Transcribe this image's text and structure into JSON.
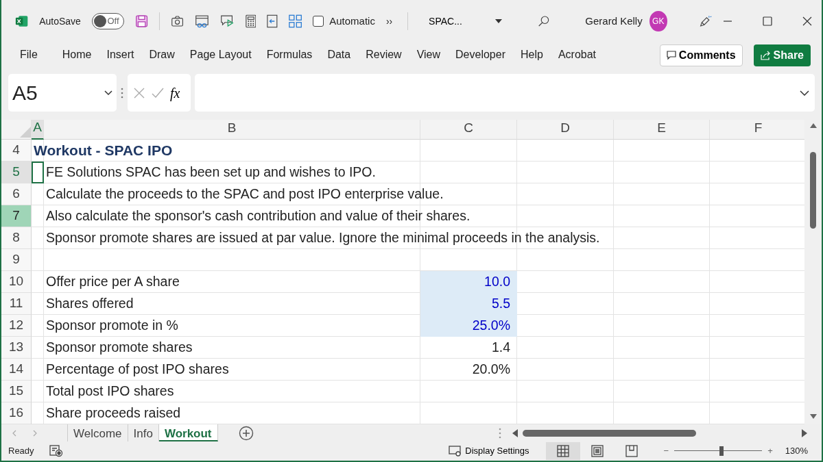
{
  "title_bar": {
    "autosave_label": "AutoSave",
    "autosave_on": false,
    "autosave_state": "Off",
    "calc_mode": {
      "label": "Automatic",
      "checked": false
    },
    "more": "››",
    "file_name": "SPAC...",
    "user_name": "Gerard Kelly",
    "user_initials": "GK"
  },
  "ribbon_tabs": [
    {
      "label": "File",
      "selected": false
    },
    {
      "label": "Home",
      "selected": false
    },
    {
      "label": "Insert",
      "selected": false
    },
    {
      "label": "Draw",
      "selected": false
    },
    {
      "label": "Page Layout",
      "selected": false
    },
    {
      "label": "Formulas",
      "selected": false
    },
    {
      "label": "Data",
      "selected": false
    },
    {
      "label": "Review",
      "selected": false
    },
    {
      "label": "View",
      "selected": false
    },
    {
      "label": "Developer",
      "selected": false
    },
    {
      "label": "Help",
      "selected": false
    },
    {
      "label": "Acrobat",
      "selected": false
    }
  ],
  "comments_button": "Comments",
  "share_button": "Share",
  "formula_bar": {
    "name_box": "A5",
    "function_label": "fx"
  },
  "sheet": {
    "columns": [
      {
        "label": "A",
        "selected": true
      },
      {
        "label": "B",
        "selected": false
      },
      {
        "label": "C",
        "selected": false
      },
      {
        "label": "D",
        "selected": false
      },
      {
        "label": "E",
        "selected": false
      },
      {
        "label": "F",
        "selected": false
      }
    ],
    "rows": [
      {
        "number": "4",
        "active": false,
        "hovered": false,
        "title": "Workout - SPAC IPO"
      },
      {
        "number": "5",
        "active": true,
        "hovered": false,
        "text": "FE Solutions SPAC has been set up and wishes to IPO."
      },
      {
        "number": "6",
        "active": false,
        "hovered": false,
        "text": "Calculate the proceeds to the SPAC and post IPO enterprise value."
      },
      {
        "number": "7",
        "active": false,
        "hovered": true,
        "text": "Also calculate the sponsor's cash contribution and value of their shares."
      },
      {
        "number": "8",
        "active": false,
        "hovered": false,
        "text": "Sponsor promote shares are issued at par value. Ignore the minimal proceeds in the analysis."
      },
      {
        "number": "9",
        "active": false,
        "hovered": false
      },
      {
        "number": "10",
        "active": false,
        "hovered": false,
        "text": "Offer price per A share",
        "value": "10.0",
        "input": true
      },
      {
        "number": "11",
        "active": false,
        "hovered": false,
        "text": "Shares offered",
        "value": "5.5",
        "input": true
      },
      {
        "number": "12",
        "active": false,
        "hovered": false,
        "text": "Sponsor promote in %",
        "value": "25.0%",
        "input": true
      },
      {
        "number": "13",
        "active": false,
        "hovered": false,
        "text": "Sponsor promote shares",
        "value": "1.4",
        "input": false
      },
      {
        "number": "14",
        "active": false,
        "hovered": false,
        "text": "Percentage of post IPO shares",
        "value": "20.0%",
        "input": false
      },
      {
        "number": "15",
        "active": false,
        "hovered": false,
        "text": "Total post IPO shares"
      },
      {
        "number": "16",
        "active": false,
        "hovered": false,
        "text": "Share proceeds raised"
      }
    ]
  },
  "sheet_tabs": [
    {
      "label": "Welcome",
      "selected": false
    },
    {
      "label": "Info",
      "selected": false
    },
    {
      "label": "Workout",
      "selected": true
    }
  ],
  "status_bar": {
    "mode": "Ready",
    "display_settings": "Display Settings",
    "views": [
      {
        "kind": "normal",
        "selected": true
      },
      {
        "kind": "page_layout",
        "selected": false
      },
      {
        "kind": "page_break",
        "selected": false
      }
    ],
    "zoom": {
      "minus": "−",
      "plus": "+",
      "level": 0.54,
      "reading": "130%"
    }
  }
}
